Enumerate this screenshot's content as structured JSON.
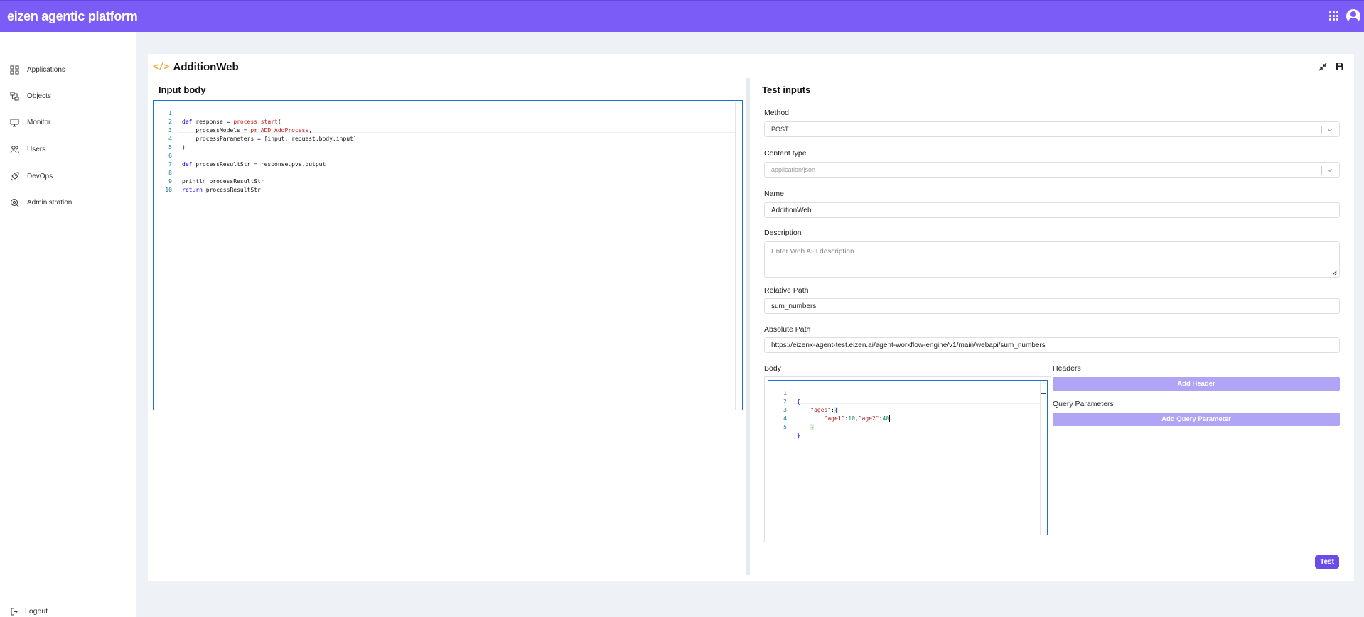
{
  "app": {
    "title": "eizen agentic platform"
  },
  "sidebar": {
    "items": [
      {
        "label": "Applications",
        "icon": "applications-icon"
      },
      {
        "label": "Objects",
        "icon": "objects-icon"
      },
      {
        "label": "Monitor",
        "icon": "monitor-icon"
      },
      {
        "label": "Users",
        "icon": "users-icon"
      },
      {
        "label": "DevOps",
        "icon": "rocket-icon"
      },
      {
        "label": "Administration",
        "icon": "administration-icon"
      }
    ],
    "logout_label": "Logout"
  },
  "page": {
    "title": "AdditionWeb",
    "title_icon": "code-icon",
    "input_body_heading": "Input body",
    "test_inputs_heading": "Test inputs"
  },
  "input_editor": {
    "line_numbers": [
      "1",
      "2",
      "3",
      "4",
      "5",
      "6",
      "7",
      "8",
      "9",
      "10"
    ],
    "lines": [
      "def response = process.start(",
      "    processModels = pm:ADD_AddProcess,",
      "    processParameters = [input: request.body.input]",
      ")",
      "",
      "def processResultStr = response.pvs.output",
      "",
      "println processResultStr",
      "return processResultStr",
      ""
    ]
  },
  "form": {
    "method": {
      "label": "Method",
      "value": "POST"
    },
    "content_type": {
      "label": "Content type",
      "value": "application/json"
    },
    "name": {
      "label": "Name",
      "value": "AdditionWeb"
    },
    "description": {
      "label": "Description",
      "placeholder": "Enter Web API description"
    },
    "relative_path": {
      "label": "Relative Path",
      "value": "sum_numbers"
    },
    "absolute_path": {
      "label": "Absolute Path",
      "value": "https://eizenx-agent-test.eizen.ai/agent-workflow-engine/v1/main/webapi/sum_numbers"
    },
    "body": {
      "label": "Body"
    },
    "headers": {
      "label": "Headers",
      "button": "Add Header"
    },
    "query_parameters": {
      "label": "Query Parameters",
      "button": "Add Query Parameter"
    },
    "test_button": "Test"
  },
  "body_editor": {
    "line_numbers": [
      "1",
      "2",
      "3",
      "4",
      "5"
    ],
    "lines": [
      "{",
      "    \"ages\":{",
      "        \"age1\":10,\"age2\":40",
      "    }",
      "}"
    ]
  },
  "colors": {
    "brand": "#7c5cf7",
    "accent_button": "#6a4de8",
    "light_button": "#b0a4f5",
    "editor_border": "#1a73c9",
    "title_icon": "#f0a42a"
  }
}
